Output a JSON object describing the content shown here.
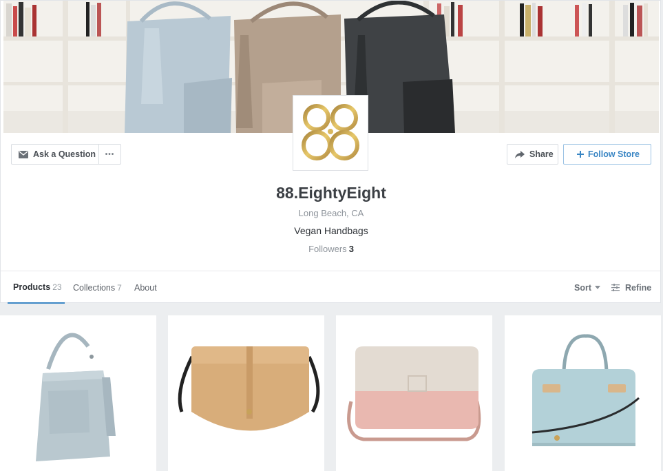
{
  "store": {
    "name": "88.EightyEight",
    "location": "Long Beach, CA",
    "tagline": "Vegan Handbags",
    "followers_label": "Followers",
    "followers_count": "3"
  },
  "actions": {
    "ask_label": "Ask a Question",
    "more_label": "•••",
    "share_label": "Share",
    "follow_label": "Follow Store"
  },
  "tabs": [
    {
      "label": "Products",
      "count": "23",
      "active": true
    },
    {
      "label": "Collections",
      "count": "7"
    },
    {
      "label": "About",
      "count": ""
    }
  ],
  "toolbar": {
    "sort_label": "Sort",
    "refine_label": "Refine"
  },
  "icons": {
    "ask": "envelope-icon",
    "share": "share-arrow-icon",
    "follow": "plus-icon",
    "sort": "caret-down-icon",
    "refine": "sliders-icon"
  },
  "colors": {
    "accent": "#3a86c4",
    "logo_gold": "#c9a24a",
    "background": "#eceef0"
  },
  "products": [
    {
      "image": "light blue tote handbag with tassel"
    },
    {
      "image": "tan saddle crossbody bag"
    },
    {
      "image": "blush and beige camera crossbody bag"
    },
    {
      "image": "light blue satchel handbag"
    }
  ]
}
